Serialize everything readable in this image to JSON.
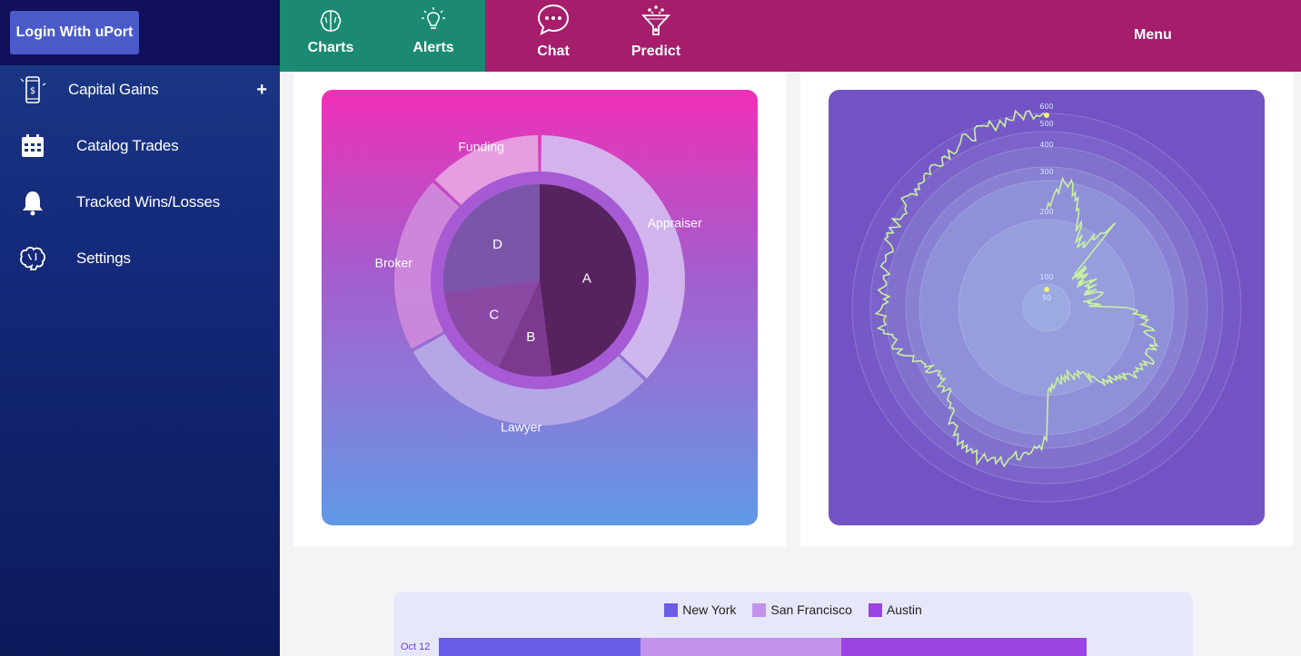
{
  "auth": {
    "login_label": "Login With uPort"
  },
  "sidebar": {
    "items": [
      {
        "label": "Capital Gains",
        "icon": "phone-dollar-icon",
        "expandable": true
      },
      {
        "label": "Catalog Trades",
        "icon": "calendar-icon"
      },
      {
        "label": "Tracked Wins/Losses",
        "icon": "bell-icon"
      },
      {
        "label": "Settings",
        "icon": "brain-icon"
      }
    ],
    "expand_glyph": "+"
  },
  "nav": {
    "tabs": [
      {
        "label": "Charts",
        "icon": "brain-icon"
      },
      {
        "label": "Alerts",
        "icon": "lightbulb-icon"
      },
      {
        "label": "Chat",
        "icon": "chat-bubble-icon"
      },
      {
        "label": "Predict",
        "icon": "funnel-icon"
      }
    ],
    "menu_label": "Menu"
  },
  "colors": {
    "sidebar_top": "#120f5a",
    "nav_green": "#1c8a72",
    "nav_magenta": "#a51d6b",
    "login_button": "#4a5bc9"
  },
  "chart_data": [
    {
      "type": "pie",
      "title": "",
      "inner": {
        "categories": [
          "A",
          "B",
          "C",
          "D"
        ],
        "values": [
          48,
          9,
          16,
          27
        ]
      },
      "outer": {
        "categories": [
          "Appraiser",
          "Lawyer",
          "Broker",
          "Funding"
        ],
        "values": [
          37,
          30,
          20,
          13
        ]
      }
    },
    {
      "type": "line",
      "title": "",
      "polar": true,
      "radial_ticks": [
        "50",
        "100",
        "200",
        "300",
        "400",
        "500",
        "600"
      ]
    },
    {
      "type": "bar",
      "orientation": "horizontal",
      "stacked": true,
      "categories": [
        "Oct 12"
      ],
      "series": [
        {
          "name": "New York",
          "color": "#6b5ce6",
          "values": [
            222
          ]
        },
        {
          "name": "San Francisco",
          "color": "#c393ec",
          "values": [
            221
          ]
        },
        {
          "name": "Austin",
          "color": "#9b44e3",
          "values": [
            270
          ]
        }
      ]
    }
  ]
}
